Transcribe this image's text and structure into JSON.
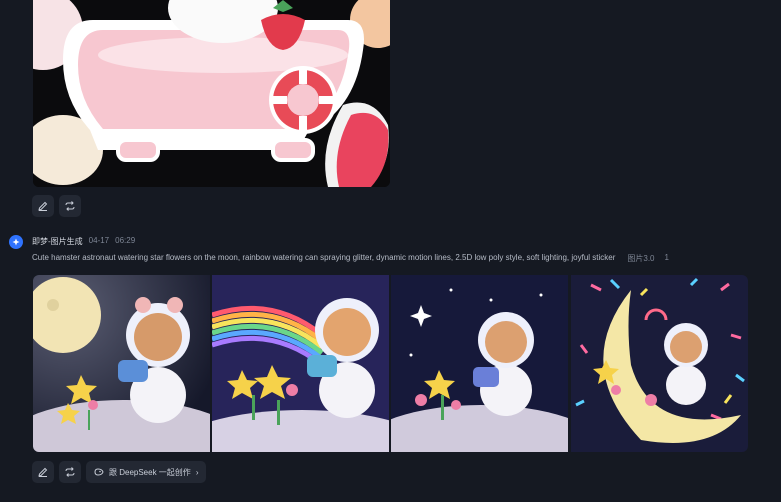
{
  "message": {
    "sender": "即梦-图片生成",
    "date": "04-17",
    "time": "06:29",
    "prompt": "Cute hamster astronaut watering star flowers on the moon, rainbow watering can spraying glitter, dynamic motion lines, 2.5D low poly style, soft lighting, joyful sticker",
    "model": "图片3.0",
    "separator": "1"
  },
  "actions": {
    "deepseek_label": "跟 DeepSeek 一起创作",
    "deepseek_chevron": "›"
  },
  "icons": {
    "edit": "edit-icon",
    "regenerate": "regenerate-icon",
    "deepseek": "deepseek-icon",
    "avatar": "app-logo-icon"
  },
  "colors": {
    "background": "#151922",
    "button": "#232833",
    "accent": "#2f73ff"
  }
}
